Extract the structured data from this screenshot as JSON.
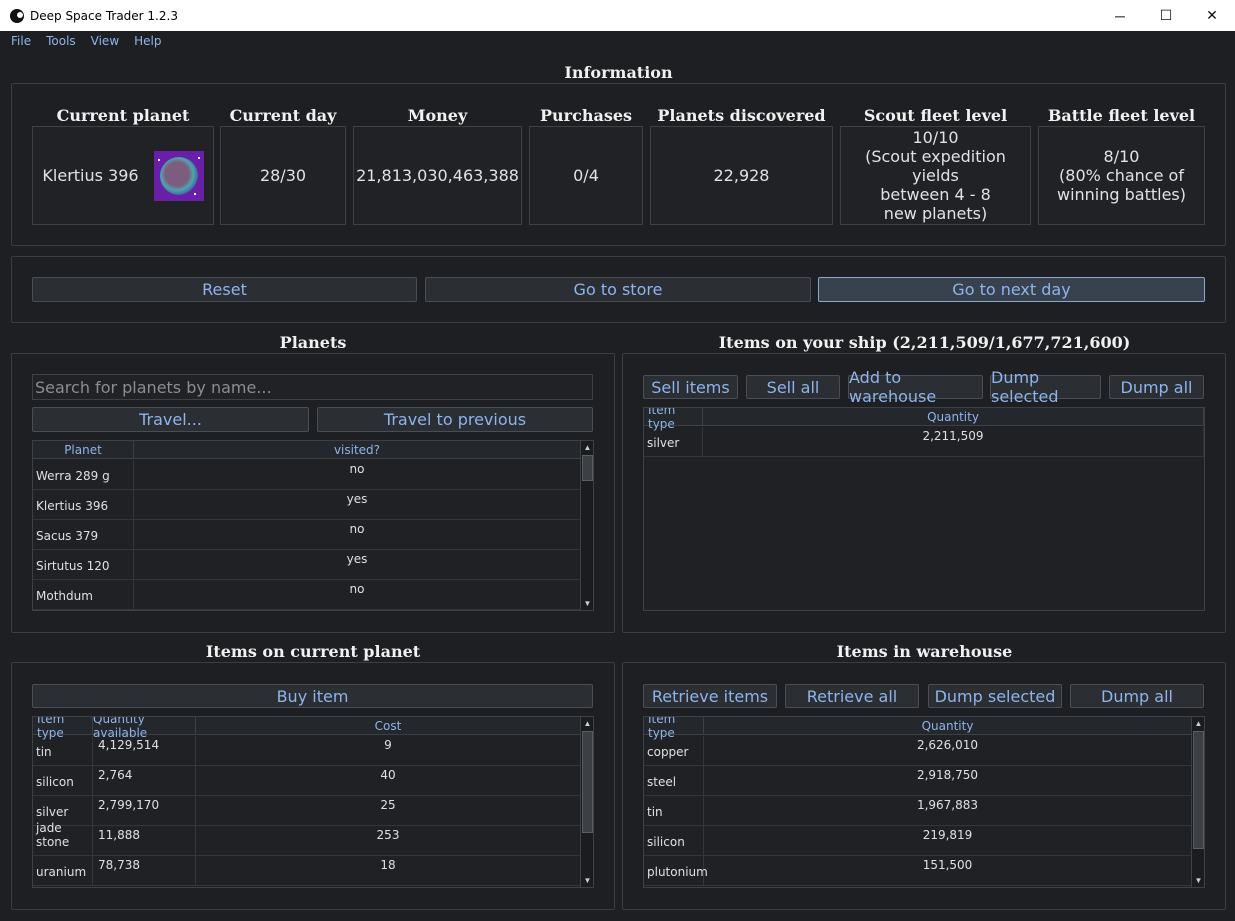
{
  "window": {
    "title": "Deep Space Trader 1.2.3",
    "minimize": "─",
    "maximize": "☐",
    "close": "✕"
  },
  "menu": [
    "File",
    "Tools",
    "View",
    "Help"
  ],
  "info": {
    "title": "Information",
    "current_planet": {
      "label": "Current planet",
      "value": "Klertius 396"
    },
    "current_day": {
      "label": "Current day",
      "value": "28/30"
    },
    "money": {
      "label": "Money",
      "value": "21,813,030,463,388"
    },
    "purchases": {
      "label": "Purchases",
      "value": "0/4"
    },
    "planets_discovered": {
      "label": "Planets discovered",
      "value": "22,928"
    },
    "scout_fleet": {
      "label": "Scout fleet level",
      "line1": "10/10",
      "line2": "(Scout expedition yields",
      "line3": "between 4 - 8",
      "line4": "new planets)"
    },
    "battle_fleet": {
      "label": "Battle fleet level",
      "line1": "8/10",
      "line2": "(80% chance of",
      "line3": "winning battles)"
    }
  },
  "actions": {
    "reset": "Reset",
    "store": "Go to store",
    "next_day": "Go to next day"
  },
  "planets": {
    "title": "Planets",
    "search_placeholder": "Search for planets by name...",
    "travel": "Travel...",
    "travel_previous": "Travel to previous",
    "columns": [
      "Planet",
      "visited?"
    ],
    "rows": [
      {
        "name": "Werra 289 g",
        "visited": "no"
      },
      {
        "name": "Klertius 396",
        "visited": "yes"
      },
      {
        "name": "Sacus 379",
        "visited": "no"
      },
      {
        "name": "Sirtutus 120",
        "visited": "yes"
      },
      {
        "name": "Mothdum",
        "visited": "no"
      }
    ]
  },
  "ship": {
    "title": "Items on your ship (2,211,509/1,677,721,600)",
    "buttons": [
      "Sell items",
      "Sell all",
      "Add to warehouse",
      "Dump selected",
      "Dump all"
    ],
    "columns": [
      "Item type",
      "Quantity"
    ],
    "rows": [
      {
        "item": "silver",
        "quantity": "2,211,509"
      }
    ]
  },
  "current_planet_items": {
    "title": "Items on current planet",
    "buy": "Buy item",
    "columns": [
      "Item type",
      "Quantity available",
      "Cost"
    ],
    "rows": [
      {
        "item": "tin",
        "quantity": "4,129,514",
        "cost": "9"
      },
      {
        "item": "silicon",
        "quantity": "2,764",
        "cost": "40"
      },
      {
        "item": "silver",
        "quantity": "2,799,170",
        "cost": "25"
      },
      {
        "item": "jade stone",
        "quantity": "11,888",
        "cost": "253"
      },
      {
        "item": "uranium",
        "quantity": "78,738",
        "cost": "18"
      }
    ]
  },
  "warehouse": {
    "title": "Items in warehouse",
    "buttons": [
      "Retrieve items",
      "Retrieve all",
      "Dump selected",
      "Dump all"
    ],
    "columns": [
      "Item type",
      "Quantity"
    ],
    "rows": [
      {
        "item": "copper",
        "quantity": "2,626,010"
      },
      {
        "item": "steel",
        "quantity": "2,918,750"
      },
      {
        "item": "tin",
        "quantity": "1,967,883"
      },
      {
        "item": "silicon",
        "quantity": "219,819"
      },
      {
        "item": "plutonium",
        "quantity": "151,500"
      }
    ]
  },
  "colors": {
    "accent": "#8eb4ec",
    "background": "#1d1f22",
    "border": "#3d4045"
  }
}
